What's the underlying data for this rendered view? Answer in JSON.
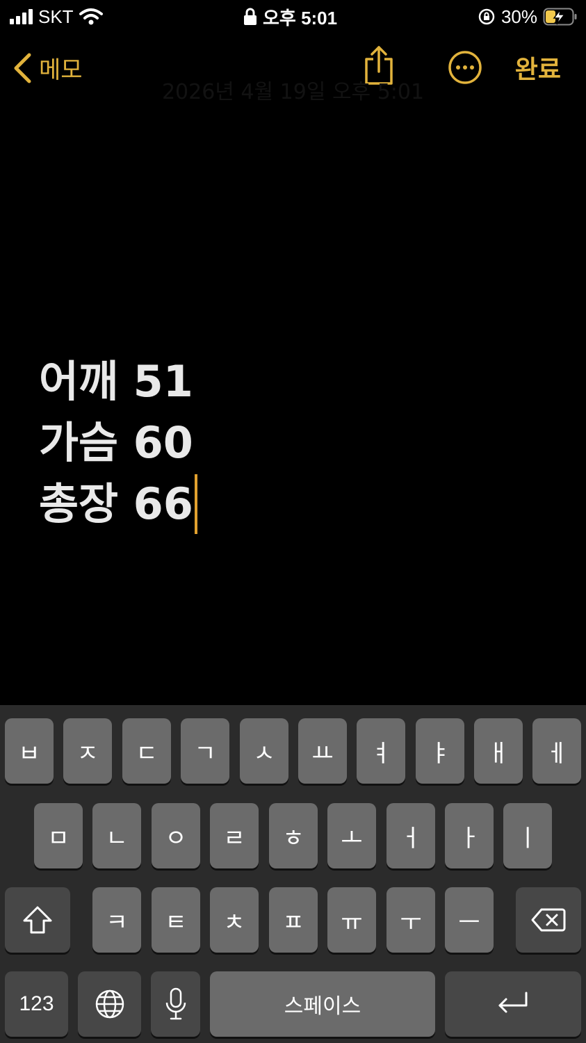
{
  "status_bar": {
    "carrier": "SKT",
    "time": "오후 5:01",
    "battery_percent": "30%",
    "icons": [
      "signal-icon",
      "wifi-icon",
      "lock-icon",
      "rotation-lock-icon",
      "battery-charging-icon"
    ]
  },
  "nav": {
    "back_label": "메모",
    "done_label": "완료",
    "icons": [
      "chevron-left-icon",
      "share-icon",
      "more-icon"
    ]
  },
  "note": {
    "date": "2026년 4월 19일 오후 5:01",
    "lines": [
      "어깨 51",
      "가슴 60",
      "총장 66"
    ]
  },
  "keyboard": {
    "row1": [
      "ㅂ",
      "ㅈ",
      "ㄷ",
      "ㄱ",
      "ㅅ",
      "ㅛ",
      "ㅕ",
      "ㅑ",
      "ㅐ",
      "ㅔ"
    ],
    "row2": [
      "ㅁ",
      "ㄴ",
      "ㅇ",
      "ㄹ",
      "ㅎ",
      "ㅗ",
      "ㅓ",
      "ㅏ",
      "ㅣ"
    ],
    "row3": [
      "ㅋ",
      "ㅌ",
      "ㅊ",
      "ㅍ",
      "ㅠ",
      "ㅜ",
      "ㅡ"
    ],
    "numbers_label": "123",
    "space_label": "스페이스",
    "icons": [
      "shift-icon",
      "backspace-icon",
      "globe-icon",
      "microphone-icon",
      "return-icon"
    ]
  },
  "colors": {
    "accent": "#e2b33c",
    "background": "#000000",
    "key": "#6b6b6b",
    "key_dark": "#474747"
  }
}
